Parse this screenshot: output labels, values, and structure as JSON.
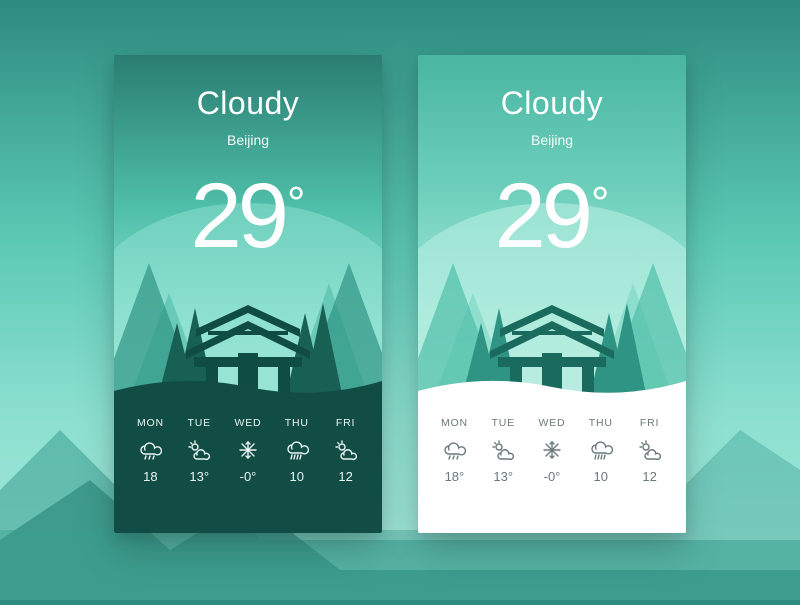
{
  "background": {
    "accent": "#5cc9b5",
    "dark": "#114d44"
  },
  "cards": [
    {
      "variant": "dark-footer",
      "condition": "Cloudy",
      "location": "Beijing",
      "temperature": "29",
      "degree_symbol": "°",
      "forecast": [
        {
          "day": "MON",
          "icon": "rain-icon",
          "temp": "18"
        },
        {
          "day": "TUE",
          "icon": "partly-cloudy-icon",
          "temp": "13°"
        },
        {
          "day": "WED",
          "icon": "snow-icon",
          "temp": "-0°"
        },
        {
          "day": "THU",
          "icon": "heavy-rain-icon",
          "temp": "10"
        },
        {
          "day": "FRI",
          "icon": "partly-cloudy-icon",
          "temp": "12"
        }
      ]
    },
    {
      "variant": "light-footer",
      "condition": "Cloudy",
      "location": "Beijing",
      "temperature": "29",
      "degree_symbol": "°",
      "forecast": [
        {
          "day": "MON",
          "icon": "rain-icon",
          "temp": "18°"
        },
        {
          "day": "TUE",
          "icon": "partly-cloudy-icon",
          "temp": "13°"
        },
        {
          "day": "WED",
          "icon": "snow-icon",
          "temp": "-0°"
        },
        {
          "day": "THU",
          "icon": "heavy-rain-icon",
          "temp": "10"
        },
        {
          "day": "FRI",
          "icon": "partly-cloudy-icon",
          "temp": "12"
        }
      ]
    }
  ]
}
